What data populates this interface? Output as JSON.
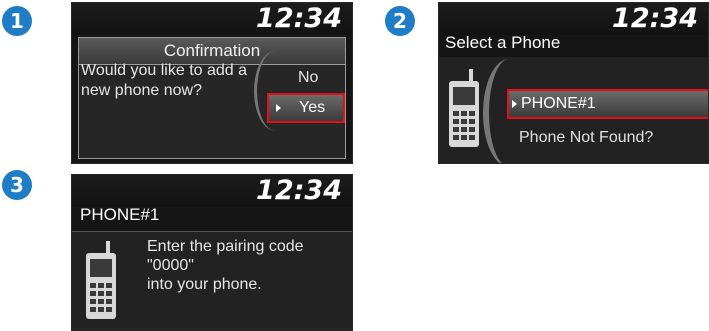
{
  "steps": [
    {
      "badge": "1",
      "clock": "12:34",
      "dialog_title": "Confirmation",
      "question_line1": "Would you like to add a",
      "question_line2": "new phone now?",
      "options": [
        "No",
        "Yes"
      ],
      "selected_option": "Yes"
    },
    {
      "badge": "2",
      "clock": "12:34",
      "title": "Select a Phone",
      "items": [
        "PHONE#1",
        "Phone Not Found?"
      ],
      "selected_item": "PHONE#1"
    },
    {
      "badge": "3",
      "clock": "12:34",
      "title": "PHONE#1",
      "message_lines": [
        "Enter the pairing code",
        "\"0000\"",
        "into your phone."
      ]
    }
  ],
  "icons": {
    "phone": "mobile-phone-icon",
    "selector": "triangle-right-icon"
  },
  "colors": {
    "step_badge": "#1f7dc6",
    "highlight_border": "#e0101d",
    "screen_bg": "#151515"
  }
}
